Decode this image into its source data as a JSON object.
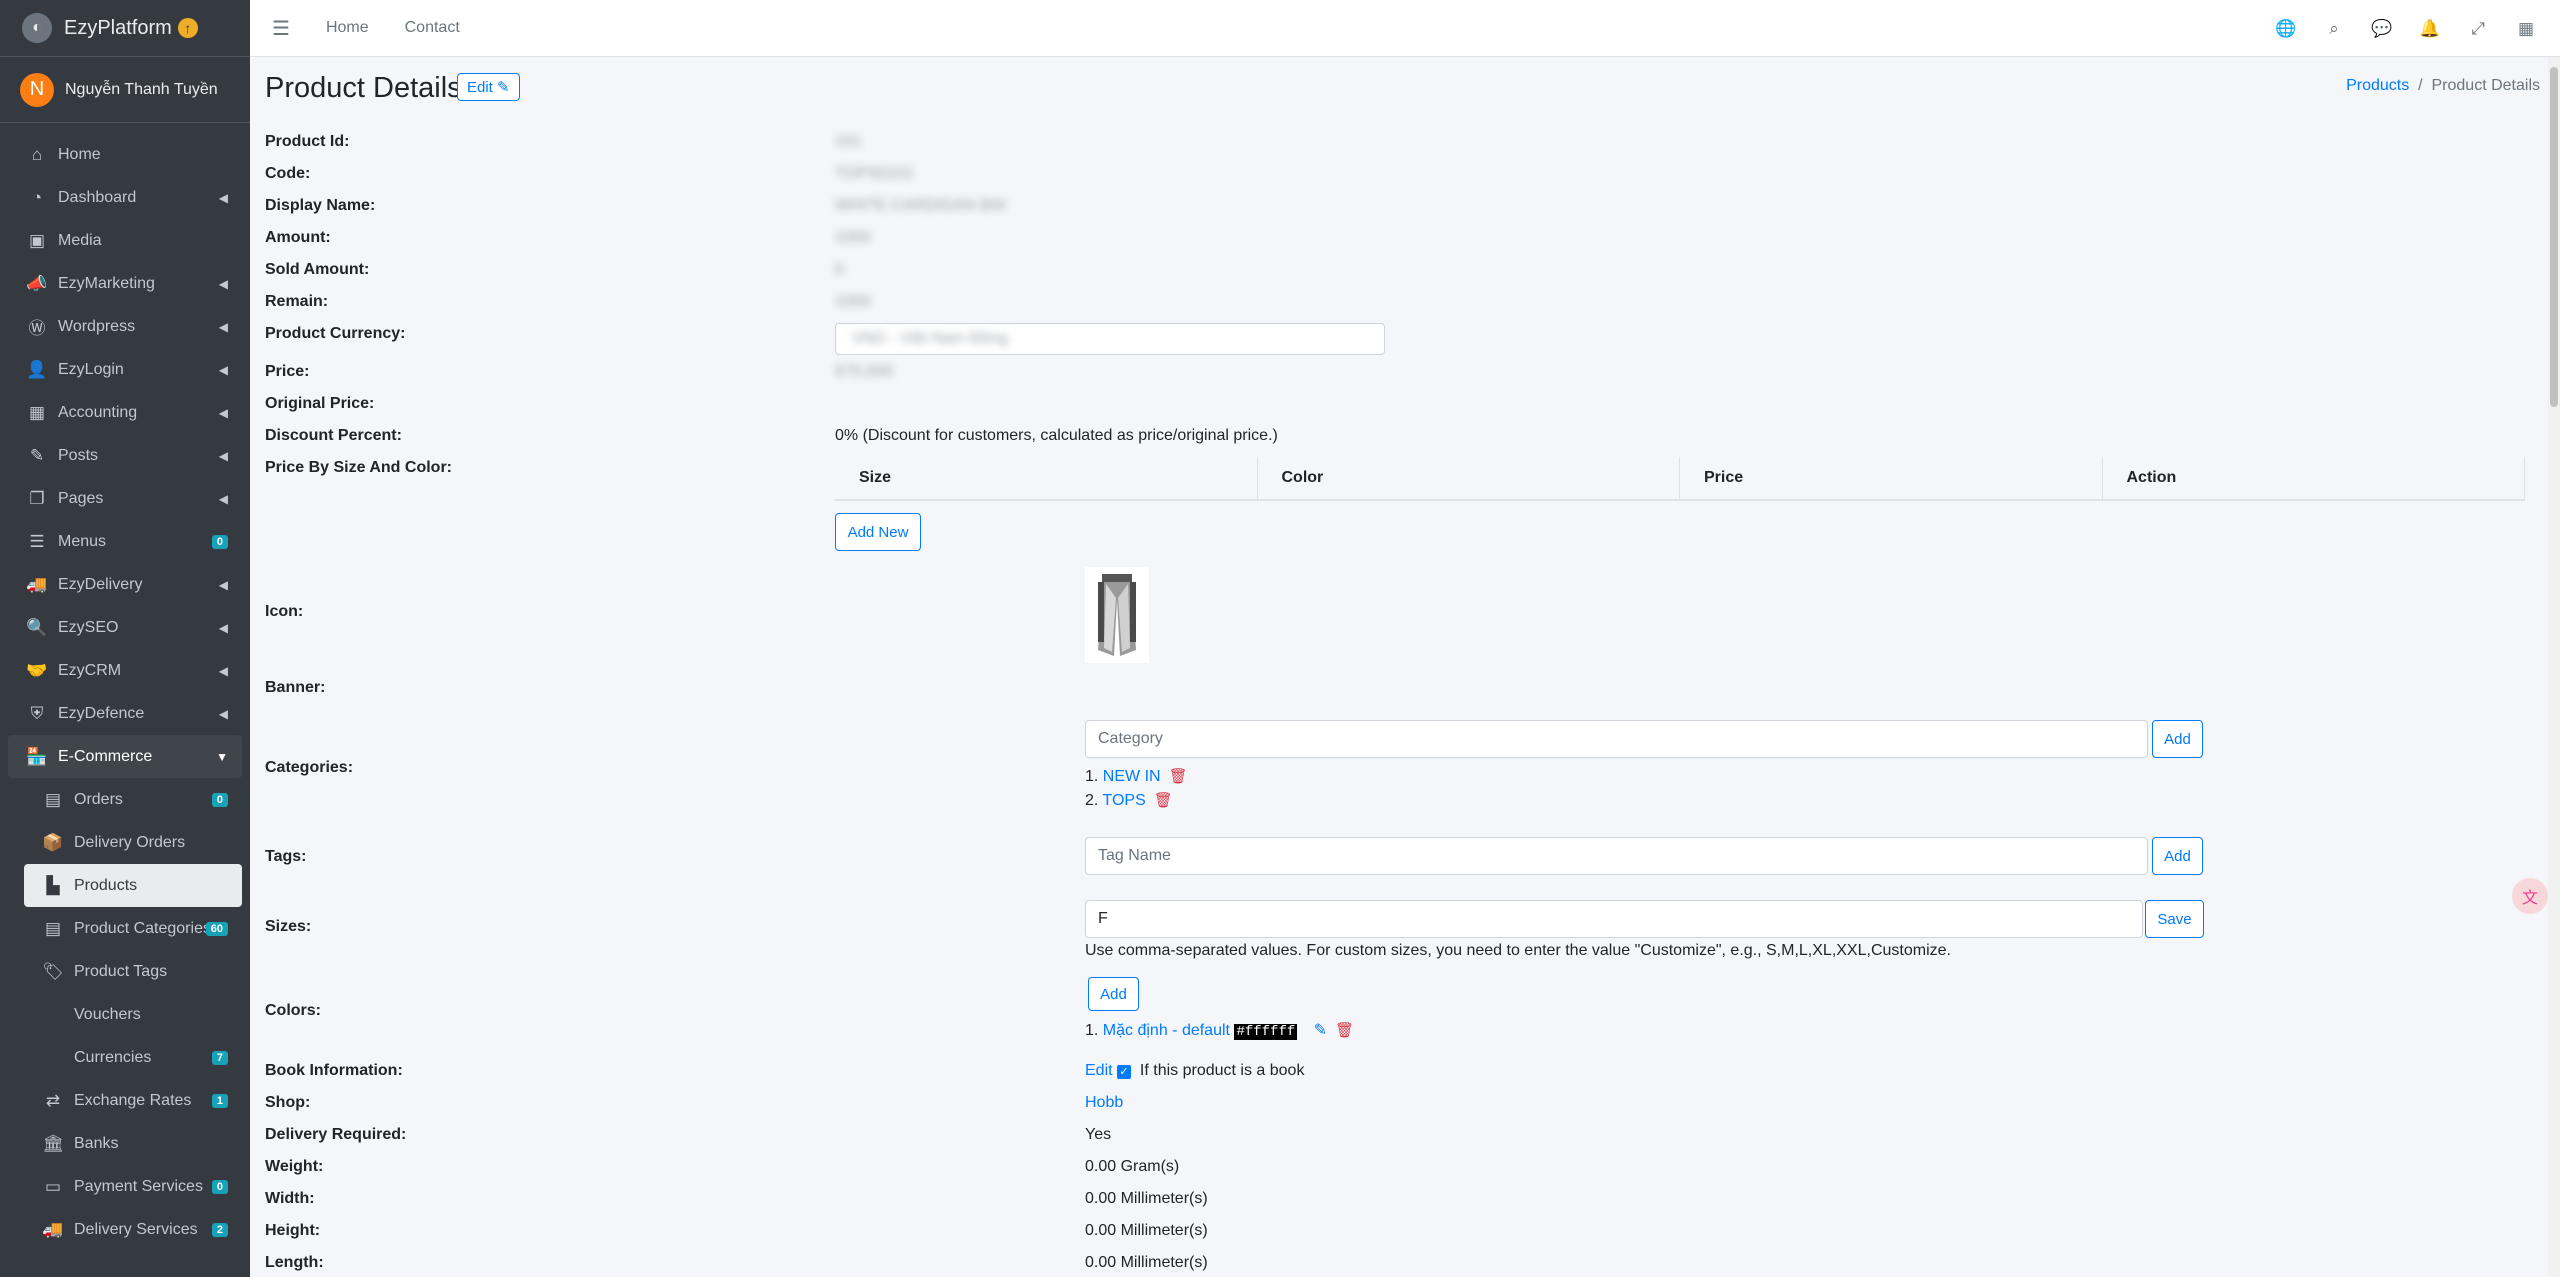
{
  "brand": {
    "name": "EzyPlatform",
    "logo_icon": "platform-logo-icon"
  },
  "user": {
    "initial": "N",
    "name": "Nguyễn Thanh Tuyền"
  },
  "sidebar": {
    "items": [
      {
        "label": "Home",
        "icon": "home-icon"
      },
      {
        "label": "Dashboard",
        "icon": "dashboard-icon"
      },
      {
        "label": "Media",
        "icon": "media-icon"
      },
      {
        "label": "EzyMarketing",
        "icon": "marketing-icon"
      },
      {
        "label": "Wordpress",
        "icon": "wordpress-icon"
      },
      {
        "label": "EzyLogin",
        "icon": "login-icon"
      },
      {
        "label": "Accounting",
        "icon": "accounting-icon"
      },
      {
        "label": "Posts",
        "icon": "posts-icon"
      },
      {
        "label": "Pages",
        "icon": "pages-icon"
      },
      {
        "label": "Menus",
        "icon": "menus-icon",
        "badge": "0"
      },
      {
        "label": "EzyDelivery",
        "icon": "delivery-icon"
      },
      {
        "label": "EzySEO",
        "icon": "seo-icon"
      },
      {
        "label": "EzyCRM",
        "icon": "crm-icon"
      },
      {
        "label": "EzyDefence",
        "icon": "shield-icon"
      },
      {
        "label": "E-Commerce",
        "icon": "shop-icon"
      }
    ],
    "ecommerce_items": [
      {
        "label": "Orders",
        "badge": "0"
      },
      {
        "label": "Delivery Orders"
      },
      {
        "label": "Products"
      },
      {
        "label": "Product Categories",
        "badge": "60"
      },
      {
        "label": "Product Tags"
      },
      {
        "label": "Vouchers"
      },
      {
        "label": "Currencies",
        "badge": "7"
      },
      {
        "label": "Exchange Rates",
        "badge": "1"
      },
      {
        "label": "Banks"
      },
      {
        "label": "Payment Services",
        "badge": "0"
      },
      {
        "label": "Delivery Services",
        "badge": "2"
      }
    ]
  },
  "topbar": {
    "home": "Home",
    "contact": "Contact"
  },
  "page": {
    "title": "Product Details",
    "edit": "Edit",
    "breadcrumb_products": "Products",
    "breadcrumb_current": "Product Details"
  },
  "fields": {
    "product_id": {
      "label": "Product Id:",
      "value": "101"
    },
    "code": {
      "label": "Code:",
      "value": "TOPS0101"
    },
    "display_name": {
      "label": "Display Name:",
      "value": "WHITE CARDIGAN BW"
    },
    "amount": {
      "label": "Amount:",
      "value": "1000"
    },
    "sold_amount": {
      "label": "Sold Amount:",
      "value": "0"
    },
    "remain": {
      "label": "Remain:",
      "value": "1000"
    },
    "currency": {
      "label": "Product Currency:",
      "value": "VND - Việt Nam Đồng"
    },
    "price": {
      "label": "Price:",
      "value": "670,000"
    },
    "original_price": {
      "label": "Original Price:",
      "value": ""
    },
    "discount": {
      "label": "Discount Percent:",
      "value": "0% (Discount for customers, calculated as price/original price.)"
    },
    "price_by_size": {
      "label": "Price By Size And Color:",
      "columns": [
        "Size",
        "Color",
        "Price",
        "Action"
      ],
      "add_new": "Add New"
    },
    "icon": {
      "label": "Icon:"
    },
    "banner": {
      "label": "Banner:"
    },
    "categories": {
      "label": "Categories:",
      "placeholder": "Category",
      "add": "Add",
      "items": [
        "1.",
        "NEW IN",
        "2.",
        "TOPS"
      ]
    },
    "tags": {
      "label": "Tags:",
      "placeholder": "Tag Name",
      "add": "Add"
    },
    "sizes": {
      "label": "Sizes:",
      "value": "F",
      "save": "Save",
      "hint": "Use comma-separated values. For custom sizes, you need to enter the value \"Customize\", e.g., S,M,L,XL,XXL,Customize."
    },
    "colors": {
      "label": "Colors:",
      "add": "Add",
      "index": "1.",
      "item": "Mặc định - default",
      "hex": "#ffffff"
    },
    "book": {
      "label": "Book Information:",
      "edit": "Edit",
      "hint": "If this product is a book"
    },
    "shop": {
      "label": "Shop:",
      "value": "Hobb"
    },
    "delivery": {
      "label": "Delivery Required:",
      "value": "Yes"
    },
    "weight": {
      "label": "Weight:",
      "value": "0.00 Gram(s)"
    },
    "width": {
      "label": "Width:",
      "value": "0.00 Millimeter(s)"
    },
    "height": {
      "label": "Height:",
      "value": "0.00 Millimeter(s)"
    },
    "length": {
      "label": "Length:",
      "value": "0.00 Millimeter(s)"
    }
  }
}
